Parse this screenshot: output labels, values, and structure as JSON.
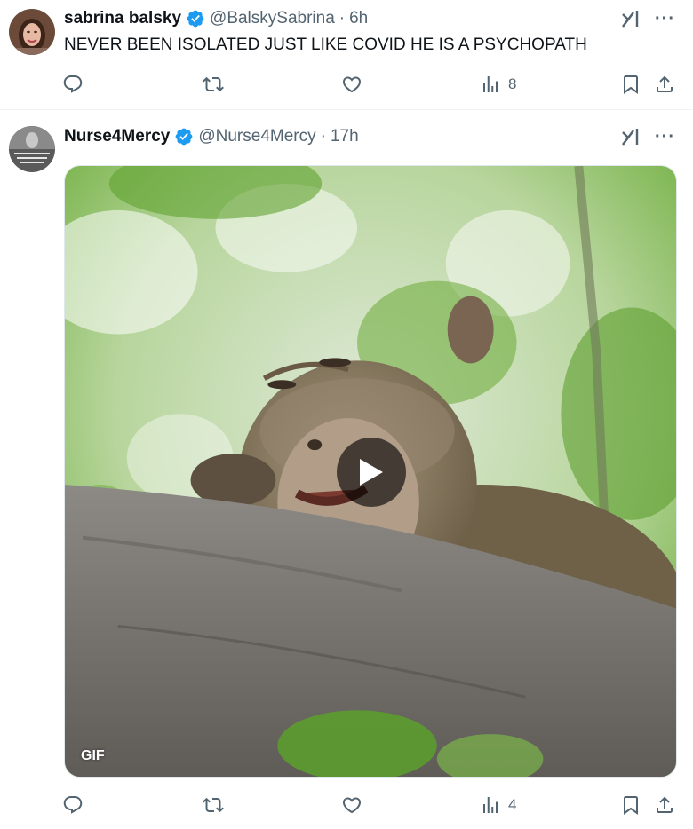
{
  "tweets": [
    {
      "name": "sabrina balsky",
      "handle": "@BalskySabrina",
      "separator": "·",
      "time": "6h",
      "text": "NEVER BEEN ISOLATED JUST LIKE COVID HE IS A PSYCHOPATH",
      "views": "8",
      "more": "···"
    },
    {
      "name": "Nurse4Mercy",
      "handle": "@Nurse4Mercy",
      "separator": "·",
      "time": "17h",
      "media_badge": "GIF",
      "views": "4",
      "more": "···"
    }
  ],
  "icons": {
    "verified": "verified-badge-icon",
    "grok": "grok-icon",
    "reply": "reply-icon",
    "repost": "repost-icon",
    "like": "like-icon",
    "views": "views-icon",
    "bookmark": "bookmark-icon",
    "share": "share-icon",
    "play": "play-icon"
  },
  "colors": {
    "verified": "#1d9bf0",
    "secondary_text": "#536471",
    "primary_text": "#0f1419"
  }
}
